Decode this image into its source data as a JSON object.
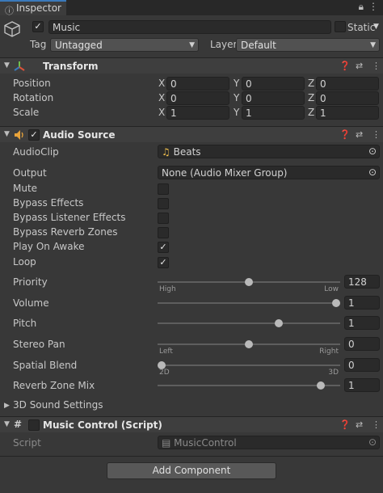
{
  "window": {
    "tab_title": "Inspector"
  },
  "object": {
    "name": "Music",
    "static_label": "Static",
    "tag_label": "Tag",
    "tag_value": "Untagged",
    "layer_label": "Layer",
    "layer_value": "Default"
  },
  "transform": {
    "title": "Transform",
    "rows": [
      {
        "label": "Position",
        "x": "0",
        "y": "0",
        "z": "0"
      },
      {
        "label": "Rotation",
        "x": "0",
        "y": "0",
        "z": "0"
      },
      {
        "label": "Scale",
        "x": "1",
        "y": "1",
        "z": "1"
      }
    ],
    "axes": {
      "x": "X",
      "y": "Y",
      "z": "Z"
    }
  },
  "audio_source": {
    "title": "Audio Source",
    "audioclip_label": "AudioClip",
    "audioclip_value": "Beats",
    "output_label": "Output",
    "output_value": "None (Audio Mixer Group)",
    "toggles": [
      {
        "label": "Mute",
        "checked": false
      },
      {
        "label": "Bypass Effects",
        "checked": false
      },
      {
        "label": "Bypass Listener Effects",
        "checked": false
      },
      {
        "label": "Bypass Reverb Zones",
        "checked": false
      },
      {
        "label": "Play On Awake",
        "checked": true
      },
      {
        "label": "Loop",
        "checked": true
      }
    ],
    "sliders": {
      "priority": {
        "label": "Priority",
        "value": "128",
        "level": 0.5,
        "min_label": "High",
        "max_label": "Low"
      },
      "volume": {
        "label": "Volume",
        "value": "1",
        "level": 1.0
      },
      "pitch": {
        "label": "Pitch",
        "value": "1",
        "level": 0.67
      },
      "stereo_pan": {
        "label": "Stereo Pan",
        "value": "0",
        "level": 0.5,
        "min_label": "Left",
        "max_label": "Right"
      },
      "spatial_blend": {
        "label": "Spatial Blend",
        "value": "0",
        "level": 0.0,
        "min_label": "2D",
        "max_label": "3D"
      },
      "reverb_zone_mix": {
        "label": "Reverb Zone Mix",
        "value": "1",
        "level": 0.91
      }
    },
    "sound_settings_label": "3D Sound Settings"
  },
  "music_control": {
    "title": "Music Control (Script)",
    "script_label": "Script",
    "script_value": "MusicControl"
  },
  "add_component_label": "Add Component",
  "icons": {
    "tab": "info-icon",
    "cube": "cube-icon",
    "transform": "transform-axes-icon",
    "audio": "speaker-icon",
    "script": "hash-script-icon",
    "help": "help-icon",
    "settings": "sliders-icon",
    "menu": "kebab-menu-icon",
    "lock": "lock-icon",
    "target": "object-picker-icon",
    "note": "music-note-icon"
  },
  "colors": {
    "background": "#383838",
    "header": "#3e3e3e",
    "field": "#2a2a2a",
    "accent": "#3a79bb",
    "audio_icon": "#e8a33a",
    "note_icon": "#f2c14e"
  }
}
